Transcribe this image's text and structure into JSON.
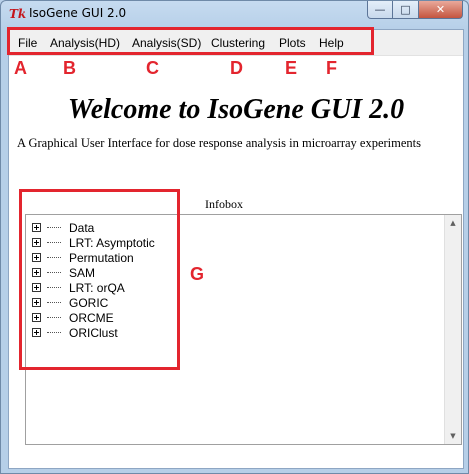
{
  "window": {
    "title": "IsoGene GUI 2.0",
    "app_icon": "tk-icon",
    "controls": {
      "minimize": "—",
      "maximize": "□",
      "close": "✕"
    }
  },
  "menubar": {
    "items": [
      {
        "label": "File",
        "annotation": "A"
      },
      {
        "label": "Analysis(HD)",
        "annotation": "B"
      },
      {
        "label": "Analysis(SD)",
        "annotation": "C"
      },
      {
        "label": "Clustering",
        "annotation": "D"
      },
      {
        "label": "Plots",
        "annotation": "E"
      },
      {
        "label": "Help",
        "annotation": "F"
      }
    ]
  },
  "main": {
    "welcome": "Welcome to IsoGene GUI 2.0",
    "subtitle": "A Graphical User Interface for dose response analysis in microarray experiments"
  },
  "infobox": {
    "label": "Infobox",
    "annotation": "G",
    "tree": [
      {
        "label": "Data"
      },
      {
        "label": "LRT: Asymptotic"
      },
      {
        "label": "Permutation"
      },
      {
        "label": "SAM"
      },
      {
        "label": "LRT: orQA"
      },
      {
        "label": "GORIC"
      },
      {
        "label": "ORCME"
      },
      {
        "label": "ORIClust"
      }
    ]
  },
  "colors": {
    "annotation_red": "#e3252e",
    "titlebar": "#b9d1ea",
    "menubar": "#f0f0f0"
  }
}
